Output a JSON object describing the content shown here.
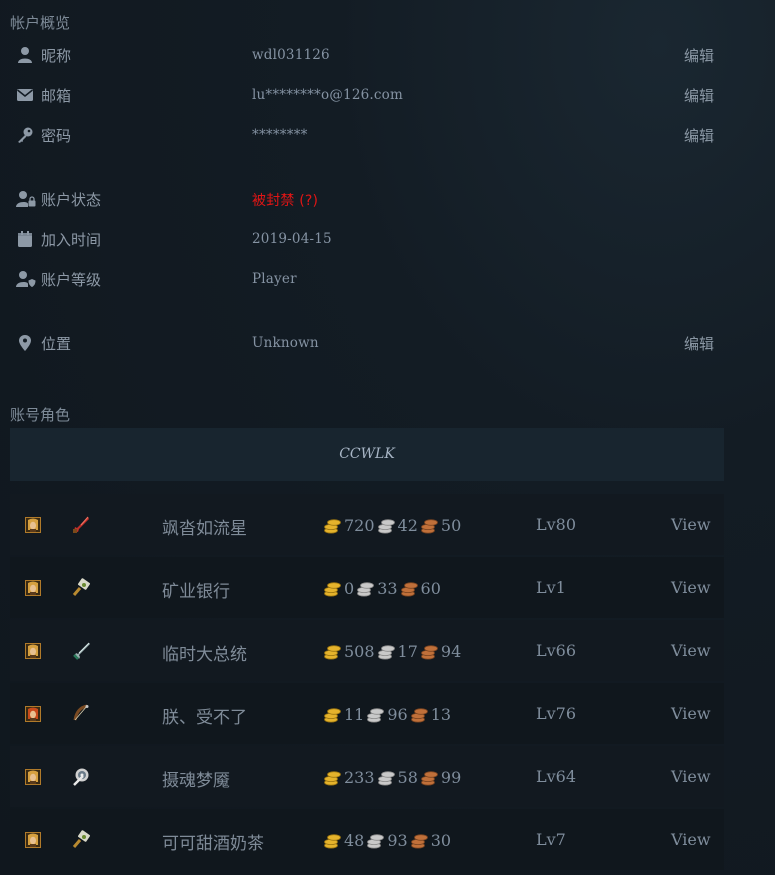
{
  "overview": {
    "title": "帐户概览",
    "edit_label": "编辑",
    "rows": [
      {
        "label": "昵称",
        "value": "wdl031126",
        "icon": "user-icon",
        "editable": true
      },
      {
        "label": "邮箱",
        "value": "lu********o@126.com",
        "icon": "mail-icon",
        "editable": true
      },
      {
        "label": "密码",
        "value": "********",
        "icon": "key-icon",
        "editable": true
      },
      {
        "label": "账户状态",
        "value": "被封禁 (?)",
        "icon": "user-lock-icon",
        "editable": false
      },
      {
        "label": "加入时间",
        "value": "2019-04-15",
        "icon": "calendar-icon",
        "editable": false
      },
      {
        "label": "账户等级",
        "value": "Player",
        "icon": "user-shield-icon",
        "editable": false
      },
      {
        "label": "位置",
        "value": "Unknown",
        "icon": "map-pin-icon",
        "editable": true
      }
    ]
  },
  "characters_section": {
    "title": "账号角色",
    "realm": "CCWLK",
    "view_label": "View",
    "characters": [
      {
        "name": "飒沓如流星",
        "gold": "720",
        "silver": "42",
        "copper": "50",
        "level": "Lv80",
        "race_icon": "human-male-icon",
        "class_icon": "rogue-dagger-icon"
      },
      {
        "name": "矿业银行",
        "gold": "0",
        "silver": "33",
        "copper": "60",
        "level": "Lv1",
        "race_icon": "human-male-icon",
        "class_icon": "paladin-hammer-icon"
      },
      {
        "name": "临时大总统",
        "gold": "508",
        "silver": "17",
        "copper": "94",
        "level": "Lv66",
        "race_icon": "human-male-icon",
        "class_icon": "warrior-sword-icon"
      },
      {
        "name": "朕、受不了",
        "gold": "11",
        "silver": "96",
        "copper": "13",
        "level": "Lv76",
        "race_icon": "human-female-icon",
        "class_icon": "hunter-bow-icon"
      },
      {
        "name": "摄魂梦魇",
        "gold": "233",
        "silver": "58",
        "copper": "99",
        "level": "Lv64",
        "race_icon": "human-male-icon",
        "class_icon": "priest-staff-icon"
      },
      {
        "name": "可可甜酒奶茶",
        "gold": "48",
        "silver": "93",
        "copper": "30",
        "level": "Lv7",
        "race_icon": "human-male-icon",
        "class_icon": "paladin-hammer-icon"
      }
    ]
  },
  "colors": {
    "background": "#10171e",
    "banned": "#e01515",
    "gold": "#e5b32c",
    "silver": "#c9c9c9",
    "copper": "#c0703a"
  }
}
